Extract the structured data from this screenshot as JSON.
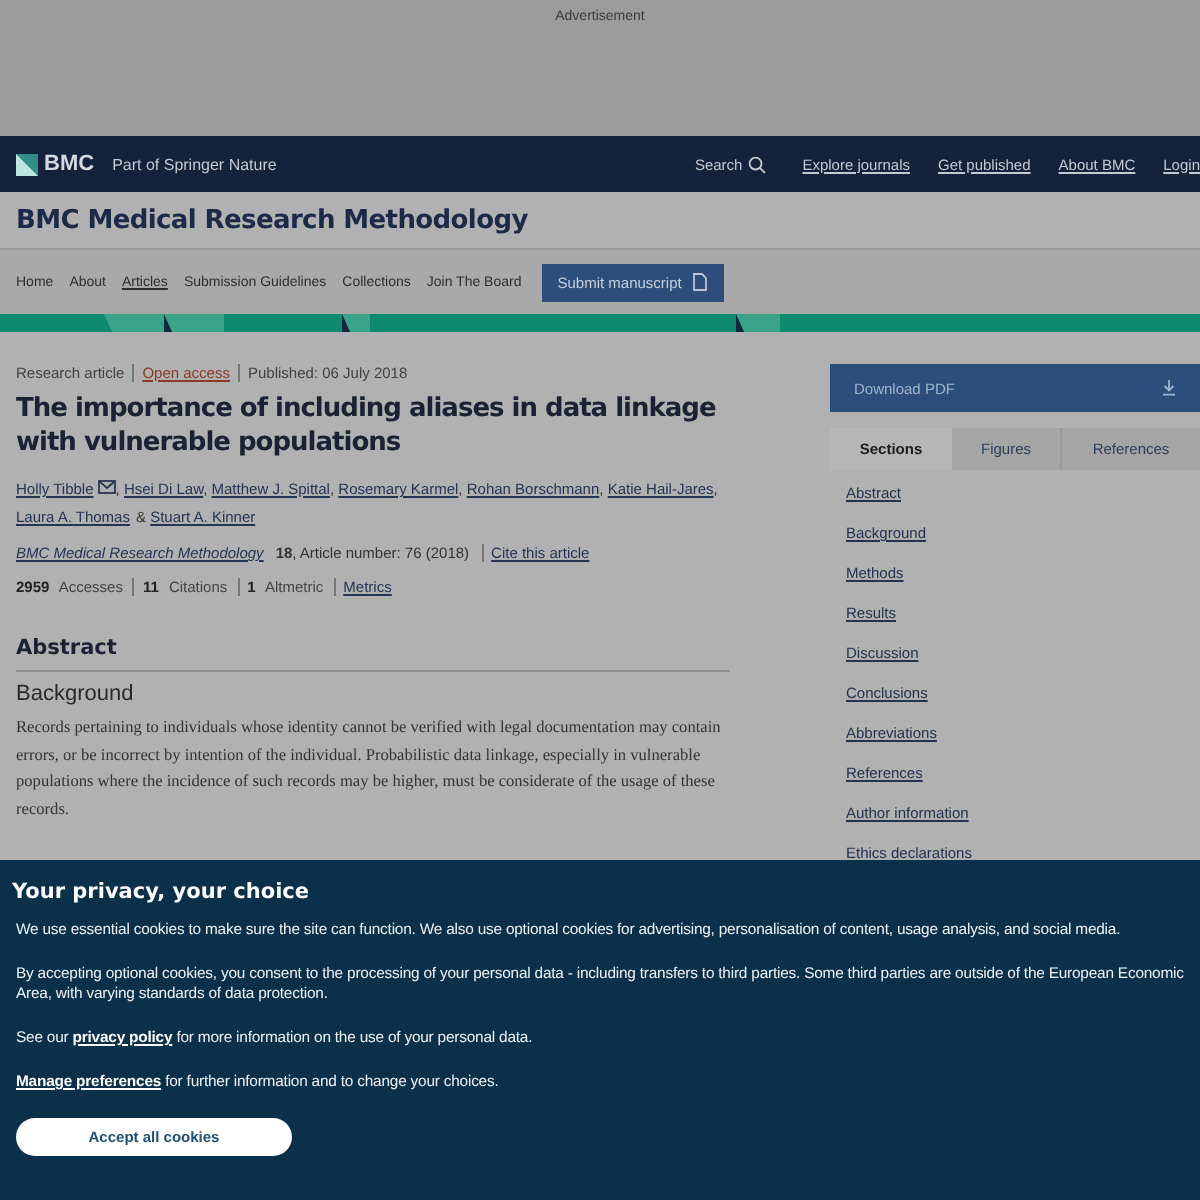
{
  "advert": {
    "label": "Advertisement"
  },
  "header": {
    "brand": "BMC",
    "tagline": "Part of Springer Nature",
    "search": "Search",
    "links": [
      "Explore journals",
      "Get published",
      "About BMC",
      "Login"
    ]
  },
  "journal_title": "BMC Medical Research Methodology",
  "nav": [
    {
      "label": "Home",
      "selected": false
    },
    {
      "label": "About",
      "selected": false
    },
    {
      "label": "Articles",
      "selected": true
    },
    {
      "label": "Submission Guidelines",
      "selected": false
    },
    {
      "label": "Collections",
      "selected": false
    },
    {
      "label": "Join The Board",
      "selected": false
    }
  ],
  "submit_button": "Submit manuscript",
  "article": {
    "type": "Research article",
    "access": "Open access",
    "published": "Published: 06 July 2018",
    "title": "The importance of including aliases in data linkage with vulnerable populations",
    "authors": [
      {
        "name": "Holly Tibble",
        "contact": true,
        "sep": ","
      },
      {
        "name": "Hsei Di Law",
        "sep": ","
      },
      {
        "name": "Matthew J. Spittal",
        "sep": ","
      },
      {
        "name": "Rosemary Karmel",
        "sep": ","
      },
      {
        "name": "Rohan Borschmann",
        "sep": ","
      },
      {
        "name": "Katie Hail-Jares",
        "sep": ","
      },
      {
        "name": "Laura A. Thomas",
        "sep": "&"
      },
      {
        "name": "Stuart A. Kinner"
      }
    ],
    "journal": "BMC Medical Research Methodology",
    "citation": "**18**, Article number: 76 (2018)",
    "cite_link": "Cite this article",
    "metrics": [
      "**2959** Accesses",
      "**11** Citations",
      "**1** Altmetric"
    ],
    "metrics_link": "Metrics",
    "abstract_heading": "Abstract",
    "background_heading": "Background",
    "background_text": "Records pertaining to individuals whose identity cannot be verified with legal documentation may contain errors, or be incorrect by intention of the individual. Probabilistic data linkage, especially in vulnerable populations where the incidence of such records may be higher, must be considerate of the usage of these records."
  },
  "sidebar": {
    "download": "Download PDF",
    "tabs": [
      {
        "label": "Sections",
        "selected": true
      },
      {
        "label": "Figures",
        "selected": false
      },
      {
        "label": "References",
        "selected": false
      }
    ],
    "items": [
      "Abstract",
      "Background",
      "Methods",
      "Results",
      "Discussion",
      "Conclusions",
      "Abbreviations",
      "References",
      "Author information",
      "Ethics declarations"
    ]
  },
  "cookie_banner": {
    "title": "Your privacy, your choice",
    "paragraphs": [
      {
        "text": "We use essential cookies to make sure the site can function. We also use optional cookies for advertising, personalisation of content, usage analysis, and social media."
      },
      {
        "text": "By accepting optional cookies, you consent to the processing of your personal data - including transfers to third parties. Some third parties are outside of the European Economic Area, with varying standards of data protection."
      },
      {
        "before": "See our",
        "link": "privacy policy",
        "after": "for more information on the use of your personal data."
      },
      {
        "link": "Manage preferences",
        "after": "for further information and to change your choices."
      }
    ],
    "accept": "Accept all cookies"
  }
}
